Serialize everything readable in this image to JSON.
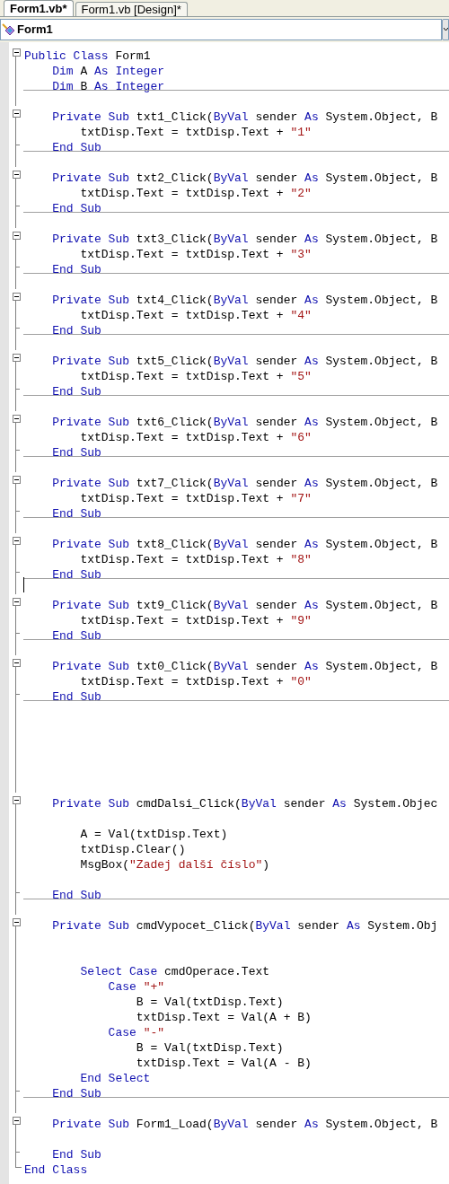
{
  "tabs": [
    {
      "label": "Form1.vb*",
      "selected": true
    },
    {
      "label": "Form1.vb [Design]*",
      "selected": false
    }
  ],
  "type_dropdown": {
    "value": "Form1"
  },
  "code_lines": [
    {
      "kind": "block_start",
      "tokens": [
        {
          "kind": "keyword",
          "text": "Public Class"
        },
        {
          "kind": "plain",
          "text": " Form1"
        }
      ]
    },
    {
      "kind": "line",
      "tokens": [
        {
          "kind": "keyword",
          "text": "    Dim"
        },
        {
          "kind": "plain",
          "text": " A "
        },
        {
          "kind": "keyword",
          "text": "As Integer"
        }
      ]
    },
    {
      "kind": "line",
      "divider_after": true,
      "tokens": [
        {
          "kind": "keyword",
          "text": "    Dim"
        },
        {
          "kind": "plain",
          "text": " B "
        },
        {
          "kind": "keyword",
          "text": "As Integer"
        }
      ]
    },
    {
      "kind": "blank"
    },
    {
      "kind": "block_start",
      "tokens": [
        {
          "kind": "keyword",
          "text": "    Private Sub"
        },
        {
          "kind": "plain",
          "text": " txt1_Click("
        },
        {
          "kind": "keyword",
          "text": "ByVal"
        },
        {
          "kind": "plain",
          "text": " sender "
        },
        {
          "kind": "keyword",
          "text": "As"
        },
        {
          "kind": "plain",
          "text": " System.Object, B"
        }
      ]
    },
    {
      "kind": "line",
      "tokens": [
        {
          "kind": "plain",
          "text": "        txtDisp.Text = txtDisp.Text + "
        },
        {
          "kind": "string",
          "text": "\"1\""
        }
      ]
    },
    {
      "kind": "block_end",
      "divider_after": true,
      "tokens": [
        {
          "kind": "keyword",
          "text": "    End Sub"
        }
      ]
    },
    {
      "kind": "blank"
    },
    {
      "kind": "block_start",
      "tokens": [
        {
          "kind": "keyword",
          "text": "    Private Sub"
        },
        {
          "kind": "plain",
          "text": " txt2_Click("
        },
        {
          "kind": "keyword",
          "text": "ByVal"
        },
        {
          "kind": "plain",
          "text": " sender "
        },
        {
          "kind": "keyword",
          "text": "As"
        },
        {
          "kind": "plain",
          "text": " System.Object, B"
        }
      ]
    },
    {
      "kind": "line",
      "tokens": [
        {
          "kind": "plain",
          "text": "        txtDisp.Text = txtDisp.Text + "
        },
        {
          "kind": "string",
          "text": "\"2\""
        }
      ]
    },
    {
      "kind": "block_end",
      "divider_after": true,
      "tokens": [
        {
          "kind": "keyword",
          "text": "    End Sub"
        }
      ]
    },
    {
      "kind": "blank"
    },
    {
      "kind": "block_start",
      "tokens": [
        {
          "kind": "keyword",
          "text": "    Private Sub"
        },
        {
          "kind": "plain",
          "text": " txt3_Click("
        },
        {
          "kind": "keyword",
          "text": "ByVal"
        },
        {
          "kind": "plain",
          "text": " sender "
        },
        {
          "kind": "keyword",
          "text": "As"
        },
        {
          "kind": "plain",
          "text": " System.Object, B"
        }
      ]
    },
    {
      "kind": "line",
      "tokens": [
        {
          "kind": "plain",
          "text": "        txtDisp.Text = txtDisp.Text + "
        },
        {
          "kind": "string",
          "text": "\"3\""
        }
      ]
    },
    {
      "kind": "block_end",
      "divider_after": true,
      "tokens": [
        {
          "kind": "keyword",
          "text": "    End Sub"
        }
      ]
    },
    {
      "kind": "blank"
    },
    {
      "kind": "block_start",
      "tokens": [
        {
          "kind": "keyword",
          "text": "    Private Sub"
        },
        {
          "kind": "plain",
          "text": " txt4_Click("
        },
        {
          "kind": "keyword",
          "text": "ByVal"
        },
        {
          "kind": "plain",
          "text": " sender "
        },
        {
          "kind": "keyword",
          "text": "As"
        },
        {
          "kind": "plain",
          "text": " System.Object, B"
        }
      ]
    },
    {
      "kind": "line",
      "tokens": [
        {
          "kind": "plain",
          "text": "        txtDisp.Text = txtDisp.Text + "
        },
        {
          "kind": "string",
          "text": "\"4\""
        }
      ]
    },
    {
      "kind": "block_end",
      "divider_after": true,
      "tokens": [
        {
          "kind": "keyword",
          "text": "    End Sub"
        }
      ]
    },
    {
      "kind": "blank"
    },
    {
      "kind": "block_start",
      "tokens": [
        {
          "kind": "keyword",
          "text": "    Private Sub"
        },
        {
          "kind": "plain",
          "text": " txt5_Click("
        },
        {
          "kind": "keyword",
          "text": "ByVal"
        },
        {
          "kind": "plain",
          "text": " sender "
        },
        {
          "kind": "keyword",
          "text": "As"
        },
        {
          "kind": "plain",
          "text": " System.Object, B"
        }
      ]
    },
    {
      "kind": "line",
      "tokens": [
        {
          "kind": "plain",
          "text": "        txtDisp.Text = txtDisp.Text + "
        },
        {
          "kind": "string",
          "text": "\"5\""
        }
      ]
    },
    {
      "kind": "block_end",
      "divider_after": true,
      "tokens": [
        {
          "kind": "keyword",
          "text": "    End Sub"
        }
      ]
    },
    {
      "kind": "blank"
    },
    {
      "kind": "block_start",
      "tokens": [
        {
          "kind": "keyword",
          "text": "    Private Sub"
        },
        {
          "kind": "plain",
          "text": " txt6_Click("
        },
        {
          "kind": "keyword",
          "text": "ByVal"
        },
        {
          "kind": "plain",
          "text": " sender "
        },
        {
          "kind": "keyword",
          "text": "As"
        },
        {
          "kind": "plain",
          "text": " System.Object, B"
        }
      ]
    },
    {
      "kind": "line",
      "tokens": [
        {
          "kind": "plain",
          "text": "        txtDisp.Text = txtDisp.Text + "
        },
        {
          "kind": "string",
          "text": "\"6\""
        }
      ]
    },
    {
      "kind": "block_end",
      "divider_after": true,
      "tokens": [
        {
          "kind": "keyword",
          "text": "    End Sub"
        }
      ]
    },
    {
      "kind": "blank"
    },
    {
      "kind": "block_start",
      "tokens": [
        {
          "kind": "keyword",
          "text": "    Private Sub"
        },
        {
          "kind": "plain",
          "text": " txt7_Click("
        },
        {
          "kind": "keyword",
          "text": "ByVal"
        },
        {
          "kind": "plain",
          "text": " sender "
        },
        {
          "kind": "keyword",
          "text": "As"
        },
        {
          "kind": "plain",
          "text": " System.Object, B"
        }
      ]
    },
    {
      "kind": "line",
      "tokens": [
        {
          "kind": "plain",
          "text": "        txtDisp.Text = txtDisp.Text + "
        },
        {
          "kind": "string",
          "text": "\"7\""
        }
      ]
    },
    {
      "kind": "block_end",
      "divider_after": true,
      "tokens": [
        {
          "kind": "keyword",
          "text": "    End Sub"
        }
      ]
    },
    {
      "kind": "blank"
    },
    {
      "kind": "block_start",
      "tokens": [
        {
          "kind": "keyword",
          "text": "    Private Sub"
        },
        {
          "kind": "plain",
          "text": " txt8_Click("
        },
        {
          "kind": "keyword",
          "text": "ByVal"
        },
        {
          "kind": "plain",
          "text": " sender "
        },
        {
          "kind": "keyword",
          "text": "As"
        },
        {
          "kind": "plain",
          "text": " System.Object, B"
        }
      ]
    },
    {
      "kind": "line",
      "tokens": [
        {
          "kind": "plain",
          "text": "        txtDisp.Text = txtDisp.Text + "
        },
        {
          "kind": "string",
          "text": "\"8\""
        }
      ]
    },
    {
      "kind": "block_end",
      "divider_after": true,
      "tokens": [
        {
          "kind": "keyword",
          "text": "    End Sub"
        }
      ]
    },
    {
      "kind": "blank",
      "caret": true
    },
    {
      "kind": "block_start",
      "tokens": [
        {
          "kind": "keyword",
          "text": "    Private Sub"
        },
        {
          "kind": "plain",
          "text": " txt9_Click("
        },
        {
          "kind": "keyword",
          "text": "ByVal"
        },
        {
          "kind": "plain",
          "text": " sender "
        },
        {
          "kind": "keyword",
          "text": "As"
        },
        {
          "kind": "plain",
          "text": " System.Object, B"
        }
      ]
    },
    {
      "kind": "line",
      "tokens": [
        {
          "kind": "plain",
          "text": "        txtDisp.Text = txtDisp.Text + "
        },
        {
          "kind": "string",
          "text": "\"9\""
        }
      ]
    },
    {
      "kind": "block_end",
      "divider_after": true,
      "tokens": [
        {
          "kind": "keyword",
          "text": "    End Sub"
        }
      ]
    },
    {
      "kind": "blank"
    },
    {
      "kind": "block_start",
      "tokens": [
        {
          "kind": "keyword",
          "text": "    Private Sub"
        },
        {
          "kind": "plain",
          "text": " txt0_Click("
        },
        {
          "kind": "keyword",
          "text": "ByVal"
        },
        {
          "kind": "plain",
          "text": " sender "
        },
        {
          "kind": "keyword",
          "text": "As"
        },
        {
          "kind": "plain",
          "text": " System.Object, B"
        }
      ]
    },
    {
      "kind": "line",
      "tokens": [
        {
          "kind": "plain",
          "text": "        txtDisp.Text = txtDisp.Text + "
        },
        {
          "kind": "string",
          "text": "\"0\""
        }
      ]
    },
    {
      "kind": "block_end",
      "divider_after": true,
      "tokens": [
        {
          "kind": "keyword",
          "text": "    End Sub"
        }
      ]
    },
    {
      "kind": "blank"
    },
    {
      "kind": "blank"
    },
    {
      "kind": "blank"
    },
    {
      "kind": "blank"
    },
    {
      "kind": "blank"
    },
    {
      "kind": "blank"
    },
    {
      "kind": "block_start",
      "tokens": [
        {
          "kind": "keyword",
          "text": "    Private Sub"
        },
        {
          "kind": "plain",
          "text": " cmdDalsi_Click("
        },
        {
          "kind": "keyword",
          "text": "ByVal"
        },
        {
          "kind": "plain",
          "text": " sender "
        },
        {
          "kind": "keyword",
          "text": "As"
        },
        {
          "kind": "plain",
          "text": " System.Objec"
        }
      ]
    },
    {
      "kind": "blank"
    },
    {
      "kind": "line",
      "tokens": [
        {
          "kind": "plain",
          "text": "        A = Val(txtDisp.Text)"
        }
      ]
    },
    {
      "kind": "line",
      "tokens": [
        {
          "kind": "plain",
          "text": "        txtDisp.Clear()"
        }
      ]
    },
    {
      "kind": "line",
      "tokens": [
        {
          "kind": "plain",
          "text": "        MsgBox("
        },
        {
          "kind": "string",
          "text": "\"Zadej další číslo\""
        },
        {
          "kind": "plain",
          "text": ")"
        }
      ]
    },
    {
      "kind": "blank"
    },
    {
      "kind": "block_end",
      "divider_after": true,
      "tokens": [
        {
          "kind": "keyword",
          "text": "    End Sub"
        }
      ]
    },
    {
      "kind": "blank"
    },
    {
      "kind": "block_start",
      "tokens": [
        {
          "kind": "keyword",
          "text": "    Private Sub"
        },
        {
          "kind": "plain",
          "text": " cmdVypocet_Click("
        },
        {
          "kind": "keyword",
          "text": "ByVal"
        },
        {
          "kind": "plain",
          "text": " sender "
        },
        {
          "kind": "keyword",
          "text": "As"
        },
        {
          "kind": "plain",
          "text": " System.Obj"
        }
      ]
    },
    {
      "kind": "blank"
    },
    {
      "kind": "blank"
    },
    {
      "kind": "line",
      "tokens": [
        {
          "kind": "keyword",
          "text": "        Select Case"
        },
        {
          "kind": "plain",
          "text": " cmdOperace.Text"
        }
      ]
    },
    {
      "kind": "line",
      "tokens": [
        {
          "kind": "keyword",
          "text": "            Case"
        },
        {
          "kind": "string",
          "text": " \"+\""
        }
      ]
    },
    {
      "kind": "line",
      "tokens": [
        {
          "kind": "plain",
          "text": "                B = Val(txtDisp.Text)"
        }
      ]
    },
    {
      "kind": "line",
      "tokens": [
        {
          "kind": "plain",
          "text": "                txtDisp.Text = Val(A + B)"
        }
      ]
    },
    {
      "kind": "line",
      "tokens": [
        {
          "kind": "keyword",
          "text": "            Case"
        },
        {
          "kind": "string",
          "text": " \"-\""
        }
      ]
    },
    {
      "kind": "line",
      "tokens": [
        {
          "kind": "plain",
          "text": "                B = Val(txtDisp.Text)"
        }
      ]
    },
    {
      "kind": "line",
      "tokens": [
        {
          "kind": "plain",
          "text": "                txtDisp.Text = Val(A - B)"
        }
      ]
    },
    {
      "kind": "line",
      "tokens": [
        {
          "kind": "keyword",
          "text": "        End Select"
        }
      ]
    },
    {
      "kind": "block_end",
      "divider_after": true,
      "tokens": [
        {
          "kind": "keyword",
          "text": "    End Sub"
        }
      ]
    },
    {
      "kind": "blank"
    },
    {
      "kind": "block_start",
      "tokens": [
        {
          "kind": "keyword",
          "text": "    Private Sub"
        },
        {
          "kind": "plain",
          "text": " Form1_Load("
        },
        {
          "kind": "keyword",
          "text": "ByVal"
        },
        {
          "kind": "plain",
          "text": " sender "
        },
        {
          "kind": "keyword",
          "text": "As"
        },
        {
          "kind": "plain",
          "text": " System.Object, B"
        }
      ]
    },
    {
      "kind": "blank"
    },
    {
      "kind": "block_end",
      "tokens": [
        {
          "kind": "keyword",
          "text": "    End Sub"
        }
      ]
    },
    {
      "kind": "class_end",
      "tokens": [
        {
          "kind": "keyword",
          "text": "End Class"
        }
      ]
    }
  ]
}
